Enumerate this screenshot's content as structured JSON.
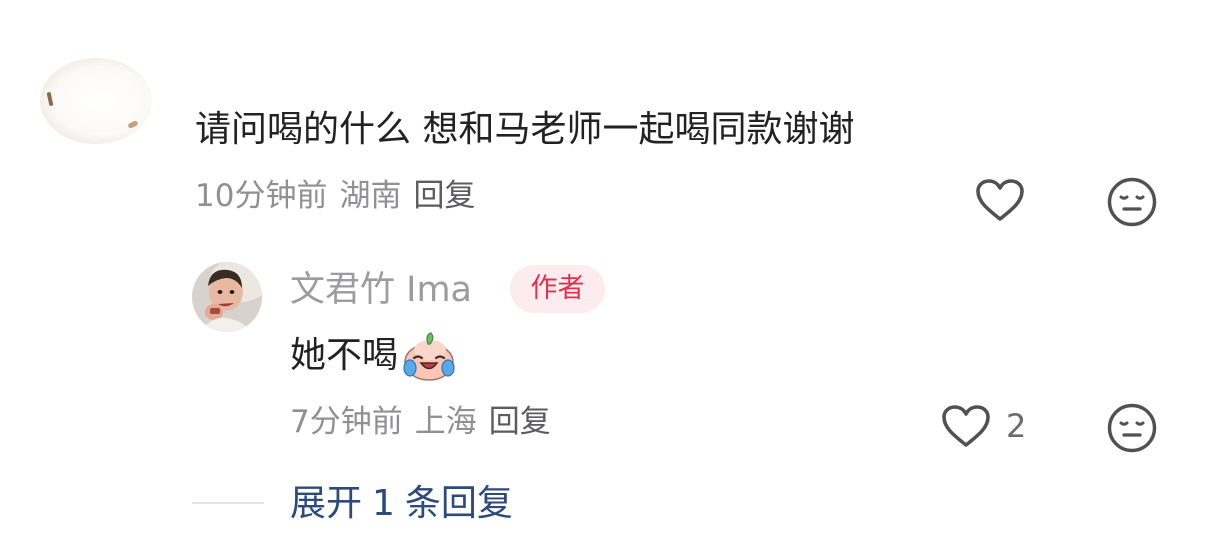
{
  "top_comment": {
    "text": "请问喝的什么 想和马老师一起喝同款谢谢",
    "time": "10分钟前",
    "location": "湖南",
    "reply_label": "回复"
  },
  "reply": {
    "username": "文君竹 Ima",
    "badge": "作者",
    "text": "她不喝",
    "emoji": "crying-laughing-peach-emoji",
    "time": "7分钟前",
    "location": "上海",
    "reply_label": "回复",
    "like_count": "2"
  },
  "expand": {
    "label": "展开",
    "count": "1",
    "suffix": "条回复"
  },
  "colors": {
    "badge_text": "#e0324f",
    "badge_bg": "#fdecef",
    "link": "#2c4a7a",
    "meta": "#8f8f94",
    "icon": "#505055"
  }
}
